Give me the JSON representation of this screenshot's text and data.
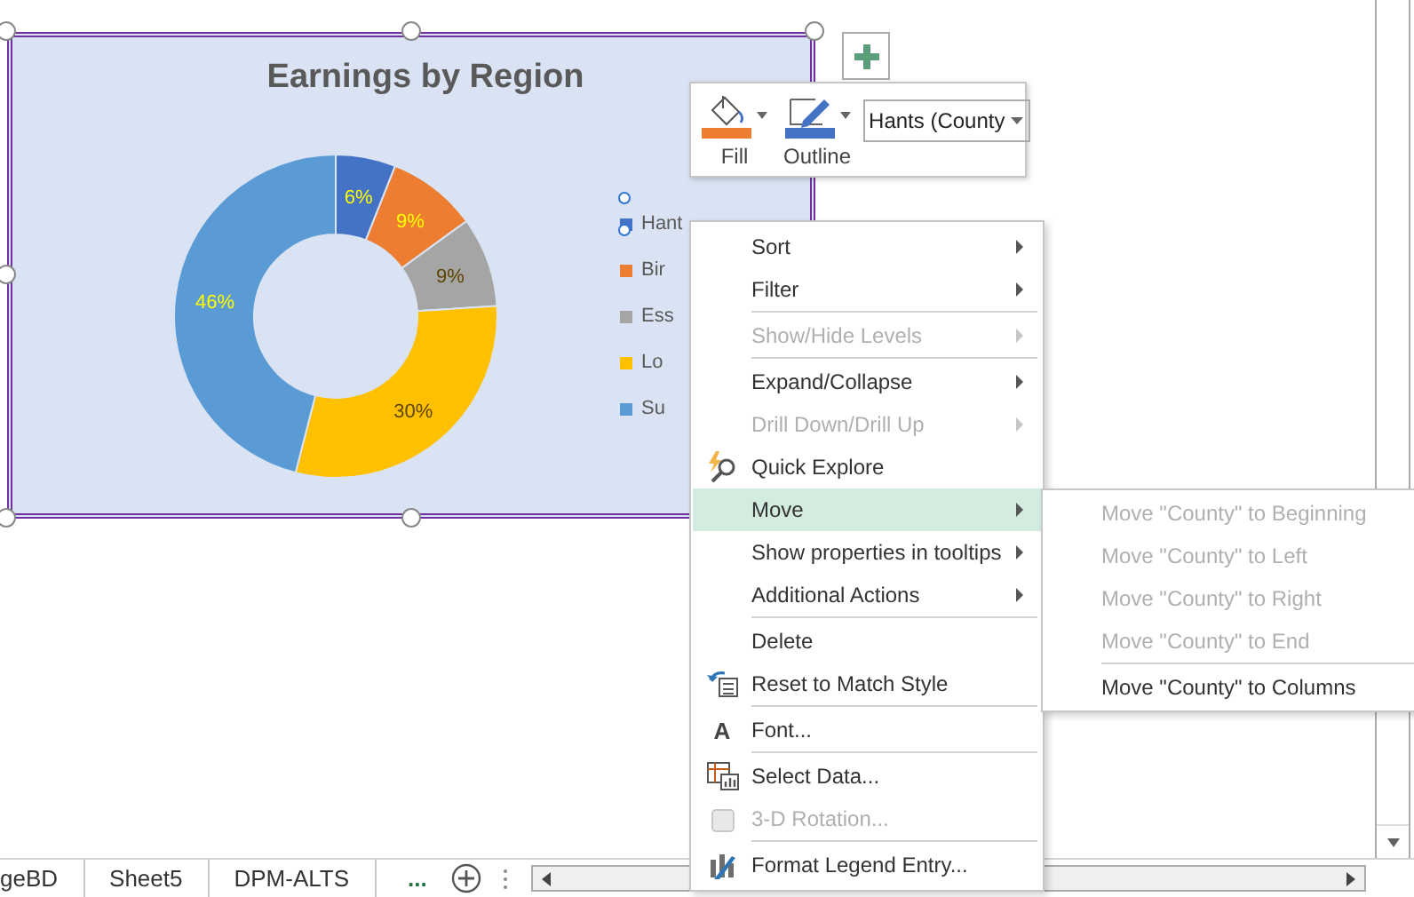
{
  "chart": {
    "selected": true,
    "legend_selected": true,
    "chart_data": {
      "type": "donut",
      "title": "Earnings by Region",
      "categories": [
        "Hant",
        "Bir",
        "Ess",
        "Lo",
        "Su"
      ],
      "values": [
        6,
        9,
        9,
        30,
        46
      ],
      "colors": [
        "#4472c4",
        "#ed7d31",
        "#a5a5a5",
        "#ffc000",
        "#5b9bd5"
      ],
      "value_labels": [
        "6%",
        "9%",
        "9%",
        "30%",
        "46%"
      ]
    }
  },
  "mini_toolbar": {
    "buttons": [
      {
        "label": "Fill",
        "color": "#ed7d31"
      },
      {
        "label": "Outline",
        "color": "#4472c4"
      }
    ],
    "dropdown": {
      "value": "Hants (County"
    }
  },
  "context_menu": {
    "items": [
      {
        "kind": "submenu",
        "label": "Sort",
        "disabled": false,
        "selected": false
      },
      {
        "kind": "submenu",
        "label": "Filter",
        "disabled": false,
        "selected": false
      },
      {
        "kind": "separator"
      },
      {
        "kind": "submenu",
        "label": "Show/Hide Levels",
        "disabled": true,
        "selected": false
      },
      {
        "kind": "separator"
      },
      {
        "kind": "submenu",
        "label": "Expand/Collapse",
        "disabled": false,
        "selected": false
      },
      {
        "kind": "submenu",
        "label": "Drill Down/Drill Up",
        "disabled": true,
        "selected": false
      },
      {
        "kind": "command",
        "label": "Quick Explore",
        "disabled": false,
        "selected": false
      },
      {
        "kind": "submenu",
        "label": "Move",
        "disabled": false,
        "selected": true
      },
      {
        "kind": "submenu",
        "label": "Show properties in tooltips",
        "disabled": false,
        "selected": false
      },
      {
        "kind": "submenu",
        "label": "Additional Actions",
        "disabled": false,
        "selected": false
      },
      {
        "kind": "separator"
      },
      {
        "kind": "command",
        "label": "Delete",
        "disabled": false,
        "selected": false
      },
      {
        "kind": "command",
        "label": "Reset to Match Style",
        "disabled": false,
        "selected": false
      },
      {
        "kind": "separator"
      },
      {
        "kind": "command",
        "label": "Font...",
        "glyph": "A",
        "disabled": false,
        "selected": false
      },
      {
        "kind": "separator"
      },
      {
        "kind": "command",
        "label": "Select Data...",
        "disabled": false,
        "selected": false
      },
      {
        "kind": "command",
        "label": "3-D Rotation...",
        "disabled": true,
        "selected": false
      },
      {
        "kind": "separator"
      },
      {
        "kind": "command",
        "label": "Format Legend Entry...",
        "disabled": false,
        "selected": false
      }
    ]
  },
  "submenu": {
    "items": [
      {
        "kind": "command",
        "label": "Move \"County\" to Beginning",
        "disabled": true
      },
      {
        "kind": "command",
        "label": "Move \"County\" to Left",
        "disabled": true
      },
      {
        "kind": "command",
        "label": "Move \"County\" to Right",
        "disabled": true
      },
      {
        "kind": "command",
        "label": "Move \"County\" to End",
        "disabled": true
      },
      {
        "kind": "separator"
      },
      {
        "kind": "command",
        "label": "Move \"County\" to Columns",
        "disabled": false
      }
    ]
  },
  "sheet_tabs": {
    "tabs": [
      {
        "label": "geBD",
        "selected": false
      },
      {
        "label": "Sheet5",
        "selected": false
      },
      {
        "label": "DPM-ALTS",
        "selected": false
      }
    ],
    "more": "..."
  }
}
